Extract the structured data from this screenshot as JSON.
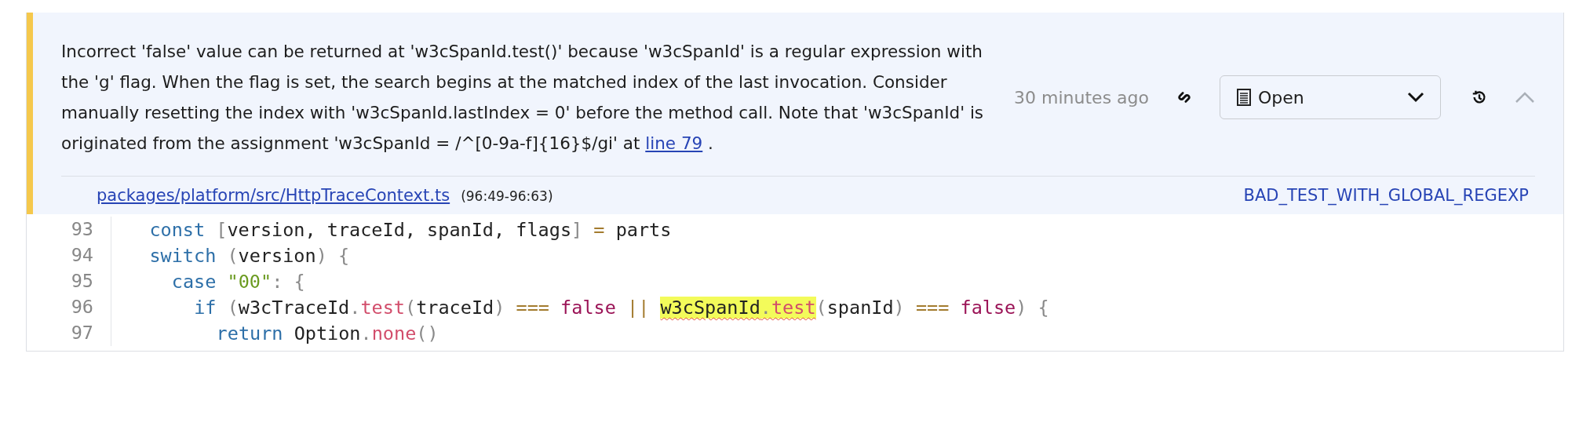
{
  "issue": {
    "message": {
      "before": "Incorrect 'false' value can be returned at 'w3cSpanId.test()' because 'w3cSpanId' is a regular expression with the 'g' flag. When the flag is set, the search begins at the matched index of the last invocation. Consider manually resetting the index with 'w3cSpanId.lastIndex = 0' before the method call. Note that 'w3cSpanId' is originated from the assignment 'w3cSpanId = /^[0-9a-f]{16}$/gi' at ",
      "link": "line 79",
      "after": " ."
    },
    "time": "30 minutes ago",
    "status": {
      "label": "Open"
    },
    "expanded": true,
    "file": "packages/platform/src/HttpTraceContext.ts",
    "range": "(96:49-96:63)",
    "rule": "BAD_TEST_WITH_GLOBAL_REGEXP"
  },
  "code": [
    {
      "number": "93",
      "tokens": [
        {
          "kind": "keyword",
          "text": "const"
        },
        {
          "kind": "punct",
          "text": " ["
        },
        {
          "kind": "plain",
          "text": "version, traceId, spanId, flags"
        },
        {
          "kind": "punct",
          "text": "]"
        },
        {
          "kind": "op",
          "text": " ="
        },
        {
          "kind": "plain",
          "text": " parts"
        }
      ]
    },
    {
      "number": "94",
      "tokens": [
        {
          "kind": "keyword",
          "text": "switch"
        },
        {
          "kind": "punct",
          "text": " ("
        },
        {
          "kind": "plain",
          "text": "version"
        },
        {
          "kind": "punct",
          "text": ")"
        },
        {
          "kind": "punct",
          "text": " {"
        }
      ],
      "children": [
        {
          "number": "95",
          "tokens": [
            {
              "kind": "keyword",
              "text": "case"
            },
            {
              "kind": "string",
              "text": " \"00\""
            },
            {
              "kind": "punct",
              "text": ":"
            },
            {
              "kind": "punct",
              "text": " {"
            }
          ],
          "children": [
            {
              "number": "96",
              "tokens": [
                {
                  "kind": "keyword",
                  "text": "if"
                },
                {
                  "kind": "punct",
                  "text": " ("
                },
                {
                  "kind": "plain",
                  "text": "w3cTraceId"
                },
                {
                  "kind": "punct",
                  "text": "."
                },
                {
                  "kind": "method",
                  "text": "test"
                },
                {
                  "kind": "punct",
                  "text": "("
                },
                {
                  "kind": "plain",
                  "text": "traceId"
                },
                {
                  "kind": "punct",
                  "text": ")"
                },
                {
                  "kind": "op",
                  "text": " ==="
                },
                {
                  "kind": "bool",
                  "text": " false"
                },
                {
                  "kind": "op",
                  "text": " || "
                },
                {
                  "highlighted": true,
                  "parts": [
                    {
                      "kind": "plain",
                      "text": "w3cSpanId"
                    },
                    {
                      "kind": "punct",
                      "text": "."
                    },
                    {
                      "kind": "method",
                      "text": "test"
                    }
                  ]
                },
                {
                  "kind": "punct",
                  "text": "("
                },
                {
                  "kind": "plain",
                  "text": "spanId"
                },
                {
                  "kind": "punct",
                  "text": ")"
                },
                {
                  "kind": "op",
                  "text": " ==="
                },
                {
                  "kind": "bool",
                  "text": " false"
                },
                {
                  "kind": "punct",
                  "text": ")"
                },
                {
                  "kind": "punct",
                  "text": " {"
                }
              ],
              "children": [
                {
                  "number": "97",
                  "tokens": [
                    {
                      "kind": "keyword",
                      "text": "return"
                    },
                    {
                      "kind": "plain",
                      "text": " Option"
                    },
                    {
                      "kind": "punct",
                      "text": "."
                    },
                    {
                      "kind": "method",
                      "text": "none"
                    },
                    {
                      "kind": "punct",
                      "text": "()"
                    }
                  ]
                }
              ]
            }
          ]
        }
      ]
    }
  ]
}
